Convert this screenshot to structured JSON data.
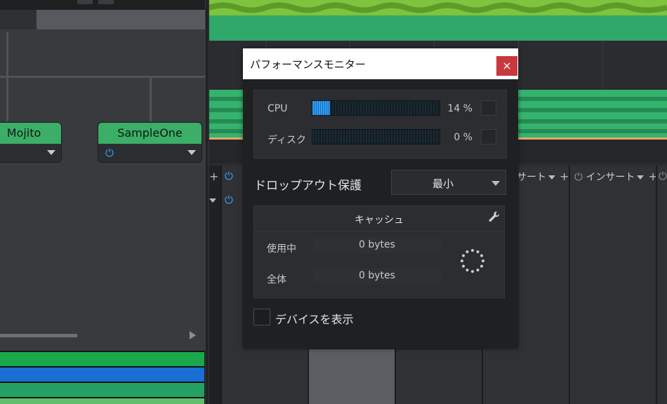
{
  "left_rack": {
    "nodes": [
      {
        "label": "Mojito"
      },
      {
        "label": "SampleOne"
      }
    ],
    "bar_colors": [
      "#1aa84a",
      "#1a6fd4",
      "#24a063",
      "#5fbf6d"
    ]
  },
  "mixer": {
    "insert_label": "インサート",
    "insert_partial_label": "サート"
  },
  "dialog": {
    "title": "パフォーマンスモニター",
    "close_symbol": "×",
    "cpu": {
      "label": "CPU",
      "percent": 14,
      "percent_text": "14 %"
    },
    "disk": {
      "label": "ディスク",
      "percent": 0,
      "percent_text": "0 %"
    },
    "dropout_protection": {
      "label": "ドロップアウト保護",
      "value": "最小"
    },
    "cache": {
      "title": "キャッシュ",
      "in_use_label": "使用中",
      "in_use_value": "0 bytes",
      "total_label": "全体",
      "total_value": "0 bytes"
    },
    "show_devices": {
      "label": "デバイスを表示",
      "checked": false
    }
  },
  "colors": {
    "accent_blue": "#3aa0ff",
    "close_red": "#c8383f",
    "node_green": "#3dae68",
    "waveform_green": "#7ec43c"
  }
}
